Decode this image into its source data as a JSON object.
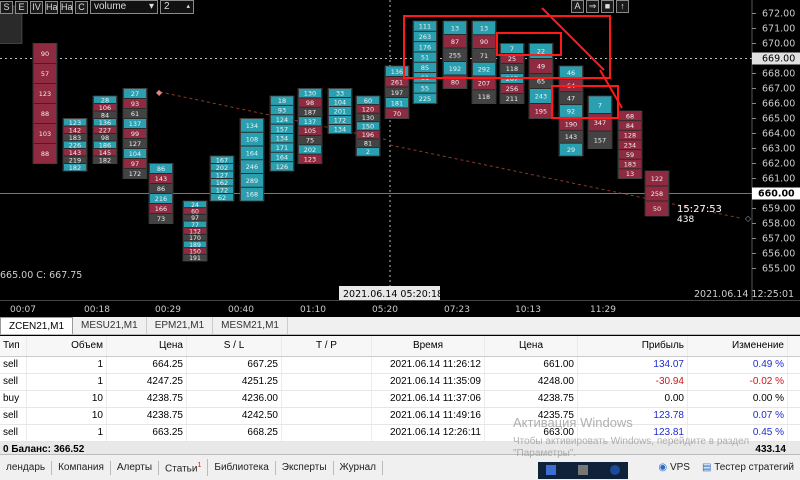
{
  "toolbar": {
    "buttons": [
      "S",
      "E",
      "IV",
      "Ha",
      "Ha",
      "C"
    ],
    "indicator_select": "volume",
    "count_value": "2",
    "right_buttons": [
      "A",
      "⇒",
      "■",
      "↑"
    ]
  },
  "price_axis": {
    "labels": [
      "672.00",
      "671.00",
      "670.00",
      "669.00",
      "668.00",
      "667.00",
      "666.00",
      "665.00",
      "664.00",
      "663.00",
      "662.00",
      "661.00",
      "660.00",
      "659.00",
      "658.00",
      "657.00",
      "656.00",
      "655.00"
    ],
    "current_price": "669.00",
    "last_price": "660.00",
    "bottom_left": "665.00  C: 667.75"
  },
  "countdown": {
    "time": "15:27:53",
    "ticks": "438"
  },
  "time_axis": {
    "labels": [
      "00:07",
      "00:18",
      "00:29",
      "00:40",
      "01:10",
      "05:20",
      "07:23",
      "10:13",
      "11:29"
    ],
    "crosshair_time": "2021.06.14 05:20:18",
    "right_time": "2021.06.14 12:25:01",
    "marker": "11:29"
  },
  "colors": {
    "bull": "#2ab4c7",
    "bear": "#a12a44",
    "neutral": "#484848",
    "box": "#ff1a1a"
  },
  "chart_data": {
    "type": "footprint",
    "ylim": [
      654.5,
      672.5
    ],
    "candles": [
      {
        "x": 10,
        "low": 670.0,
        "high": 672.5,
        "dir": "down",
        "vols": []
      },
      {
        "x": 45,
        "low": 662.0,
        "high": 670.0,
        "dir": "down",
        "vols": [
          90,
          57,
          123,
          88,
          103,
          88
        ]
      },
      {
        "x": 75,
        "low": 661.5,
        "high": 665.0,
        "dir": "mix",
        "vols": [
          123,
          142,
          183,
          226,
          143,
          219,
          182
        ]
      },
      {
        "x": 105,
        "low": 662.0,
        "high": 666.5,
        "dir": "mix",
        "vols": [
          28,
          106,
          84,
          136,
          227,
          98,
          186,
          145,
          182
        ]
      },
      {
        "x": 135,
        "low": 661.0,
        "high": 667.0,
        "dir": "mix",
        "vols": [
          27,
          93,
          61,
          137,
          99,
          127,
          104,
          97,
          172
        ]
      },
      {
        "x": 161,
        "low": 658.0,
        "high": 662.0,
        "dir": "mix",
        "vols": [
          86,
          143,
          86,
          216,
          166,
          73
        ]
      },
      {
        "x": 195,
        "low": 655.5,
        "high": 659.5,
        "dir": "mix",
        "vols": [
          24,
          60,
          97,
          77,
          132,
          170,
          189,
          150,
          191
        ]
      },
      {
        "x": 222,
        "low": 659.5,
        "high": 662.5,
        "dir": "up",
        "vols": [
          167,
          202,
          127,
          162,
          172,
          62
        ]
      },
      {
        "x": 252,
        "low": 659.5,
        "high": 665.0,
        "dir": "up",
        "vols": [
          134,
          108,
          164,
          246,
          289,
          168
        ]
      },
      {
        "x": 282,
        "low": 661.5,
        "high": 666.5,
        "dir": "up",
        "vols": [
          18,
          93,
          124,
          157,
          134,
          171,
          164,
          126
        ]
      },
      {
        "x": 310,
        "low": 662.0,
        "high": 667.0,
        "dir": "mix",
        "vols": [
          130,
          98,
          187,
          137,
          105,
          75,
          202,
          123
        ]
      },
      {
        "x": 340,
        "low": 664.0,
        "high": 667.0,
        "dir": "up",
        "vols": [
          33,
          104,
          201,
          172,
          134
        ]
      },
      {
        "x": 368,
        "low": 662.5,
        "high": 666.5,
        "dir": "mix",
        "vols": [
          60,
          120,
          130,
          150,
          196,
          81,
          2
        ]
      },
      {
        "x": 397,
        "low": 665.0,
        "high": 668.5,
        "dir": "mix",
        "vols": [
          136,
          261,
          197,
          181,
          70
        ]
      },
      {
        "x": 425,
        "low": 666.0,
        "high": 671.5,
        "dir": "up",
        "vols": [
          111,
          263,
          176,
          51,
          85,
          61,
          55,
          225
        ]
      },
      {
        "x": 455,
        "low": 667.0,
        "high": 671.5,
        "dir": "mix",
        "vols": [
          13,
          87,
          255,
          192,
          80
        ]
      },
      {
        "x": 484,
        "low": 666.0,
        "high": 671.5,
        "dir": "mix",
        "vols": [
          13,
          90,
          71,
          292,
          207,
          118
        ]
      },
      {
        "x": 512,
        "low": 666.0,
        "high": 670.0,
        "dir": "mix",
        "vols": [
          7,
          25,
          118,
          207,
          256,
          211
        ]
      },
      {
        "x": 541,
        "low": 665.0,
        "high": 670.0,
        "dir": "mix",
        "vols": [
          22,
          49,
          65,
          243,
          195
        ]
      },
      {
        "x": 571,
        "low": 662.5,
        "high": 668.5,
        "dir": "mix",
        "vols": [
          46,
          64,
          47,
          92,
          190,
          143,
          29
        ]
      },
      {
        "x": 600,
        "low": 663.0,
        "high": 666.5,
        "dir": "mix",
        "vols": [
          7,
          347,
          157
        ]
      },
      {
        "x": 630,
        "low": 661.0,
        "high": 665.5,
        "dir": "down",
        "vols": [
          68,
          84,
          128,
          234,
          59,
          183,
          13
        ]
      },
      {
        "x": 657,
        "low": 658.5,
        "high": 661.5,
        "dir": "down",
        "vols": [
          122,
          258,
          50
        ]
      }
    ]
  },
  "tabs": [
    "ZCEN21,M1",
    "MESU21,M1",
    "EPM21,M1",
    "MESM21,M1"
  ],
  "table": {
    "headers": [
      "Тип",
      "Объем",
      "Цена",
      "S / L",
      "T / P",
      "Время",
      "Цена",
      "Прибыль",
      "Изменение"
    ],
    "rows": [
      {
        "type": "sell",
        "volume": "1",
        "price": "664.25",
        "sl": "667.25",
        "tp": "",
        "time": "2021.06.14 11:26:12",
        "cur_price": "661.00",
        "profit": "134.07",
        "change": "0.49 %",
        "sign": "pos"
      },
      {
        "type": "sell",
        "volume": "1",
        "price": "4247.25",
        "sl": "4251.25",
        "tp": "",
        "time": "2021.06.14 11:35:09",
        "cur_price": "4248.00",
        "profit": "-30.94",
        "change": "-0.02 %",
        "sign": "neg"
      },
      {
        "type": "buy",
        "volume": "10",
        "price": "4238.75",
        "sl": "4236.00",
        "tp": "",
        "time": "2021.06.14 11:37:06",
        "cur_price": "4238.75",
        "profit": "0.00",
        "change": "0.00 %",
        "sign": "zero"
      },
      {
        "type": "sell",
        "volume": "10",
        "price": "4238.75",
        "sl": "4242.50",
        "tp": "",
        "time": "2021.06.14 11:49:16",
        "cur_price": "4235.75",
        "profit": "123.78",
        "change": "0.07 %",
        "sign": "pos"
      },
      {
        "type": "sell",
        "volume": "1",
        "price": "663.25",
        "sl": "668.25",
        "tp": "",
        "time": "2021.06.14 12:26:11",
        "cur_price": "663.00",
        "profit": "123.81",
        "change": "0.45 %",
        "sign": "pos"
      }
    ],
    "summary_label": "0  Баланс: 366.52",
    "summary_profit": "433.14"
  },
  "watermark": {
    "title": "Активация Windows",
    "text": "Чтобы активировать Windows, перейдите в раздел \"Параметры\"."
  },
  "bottom_tabs": [
    "лендарь",
    "Компания",
    "Алерты",
    "Статьи",
    "Библиотека",
    "Эксперты",
    "Журнал"
  ],
  "bottom_right": {
    "vps": "VPS",
    "tester": "Тестер стратегий",
    "articles_badge": "1"
  }
}
